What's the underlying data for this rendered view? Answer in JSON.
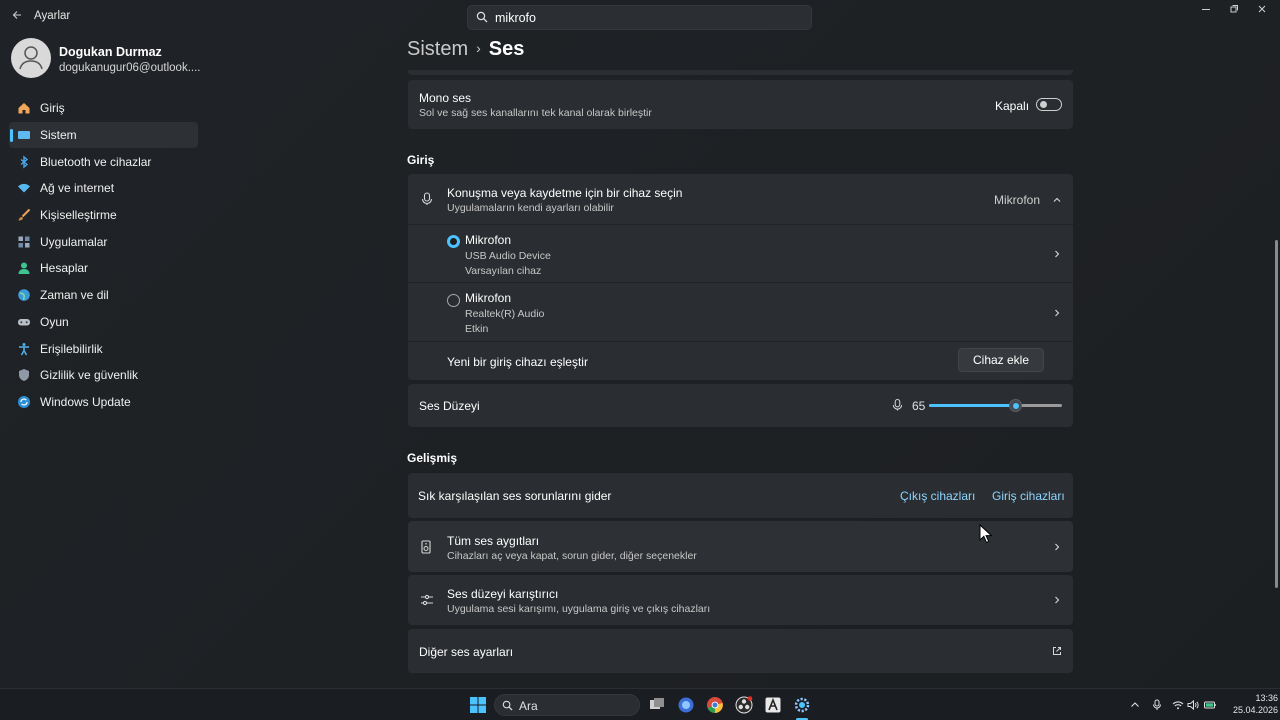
{
  "window": {
    "app_title": "Ayarlar",
    "search_value": "mikrofo",
    "accent_color": "#4cc2ff"
  },
  "profile": {
    "name": "Dogukan Durmaz",
    "email": "dogukanugur06@outlook...."
  },
  "sidebar": {
    "items": [
      {
        "label": "Giriş",
        "icon": "home-icon"
      },
      {
        "label": "Sistem",
        "icon": "system-icon",
        "active": true
      },
      {
        "label": "Bluetooth ve cihazlar",
        "icon": "bluetooth-icon"
      },
      {
        "label": "Ağ ve internet",
        "icon": "wifi-icon"
      },
      {
        "label": "Kişiselleştirme",
        "icon": "brush-icon"
      },
      {
        "label": "Uygulamalar",
        "icon": "apps-icon"
      },
      {
        "label": "Hesaplar",
        "icon": "account-icon"
      },
      {
        "label": "Zaman ve dil",
        "icon": "globe-icon"
      },
      {
        "label": "Oyun",
        "icon": "gamepad-icon"
      },
      {
        "label": "Erişilebilirlik",
        "icon": "accessibility-icon"
      },
      {
        "label": "Gizlilik ve güvenlik",
        "icon": "shield-icon"
      },
      {
        "label": "Windows Update",
        "icon": "update-icon"
      }
    ]
  },
  "breadcrumb": {
    "parent": "Sistem",
    "separator": "›",
    "current": "Ses"
  },
  "mono_audio": {
    "title": "Mono ses",
    "subtitle": "Sol ve sağ ses kanallarını tek kanal olarak birleştir",
    "state_label": "Kapalı",
    "enabled": false
  },
  "input_section": {
    "heading": "Giriş",
    "chooser": {
      "title": "Konuşma veya kaydetme için bir cihaz seçin",
      "subtitle": "Uygulamaların kendi ayarları olabilir",
      "selected": "Mikrofon"
    },
    "devices": [
      {
        "name": "Mikrofon",
        "line1": "USB Audio Device",
        "line2": "Varsayılan cihaz",
        "selected": true
      },
      {
        "name": "Mikrofon",
        "line1": "Realtek(R) Audio",
        "line2": "Etkin",
        "selected": false
      }
    ],
    "pair": {
      "label": "Yeni bir giriş cihazı eşleştir",
      "button": "Cihaz ekle"
    },
    "volume": {
      "label": "Ses Düzeyi",
      "value": "65",
      "level_percent": 65
    }
  },
  "advanced_section": {
    "heading": "Gelişmiş",
    "troubleshoot": {
      "label": "Sık karşılaşılan ses sorunlarını gider",
      "link_output": "Çıkış cihazları",
      "link_input": "Giriş cihazları"
    },
    "all_devices": {
      "title": "Tüm ses aygıtları",
      "subtitle": "Cihazları aç veya kapat, sorun gider, diğer seçenekler"
    },
    "mixer": {
      "title": "Ses düzeyi karıştırıcı",
      "subtitle": "Uygulama sesi karışımı, uygulama giriş ve çıkış cihazları"
    },
    "more": {
      "title": "Diğer ses ayarları"
    }
  },
  "taskbar": {
    "search_label": "Ara",
    "time": "13:36",
    "date": "25.04.2026"
  }
}
